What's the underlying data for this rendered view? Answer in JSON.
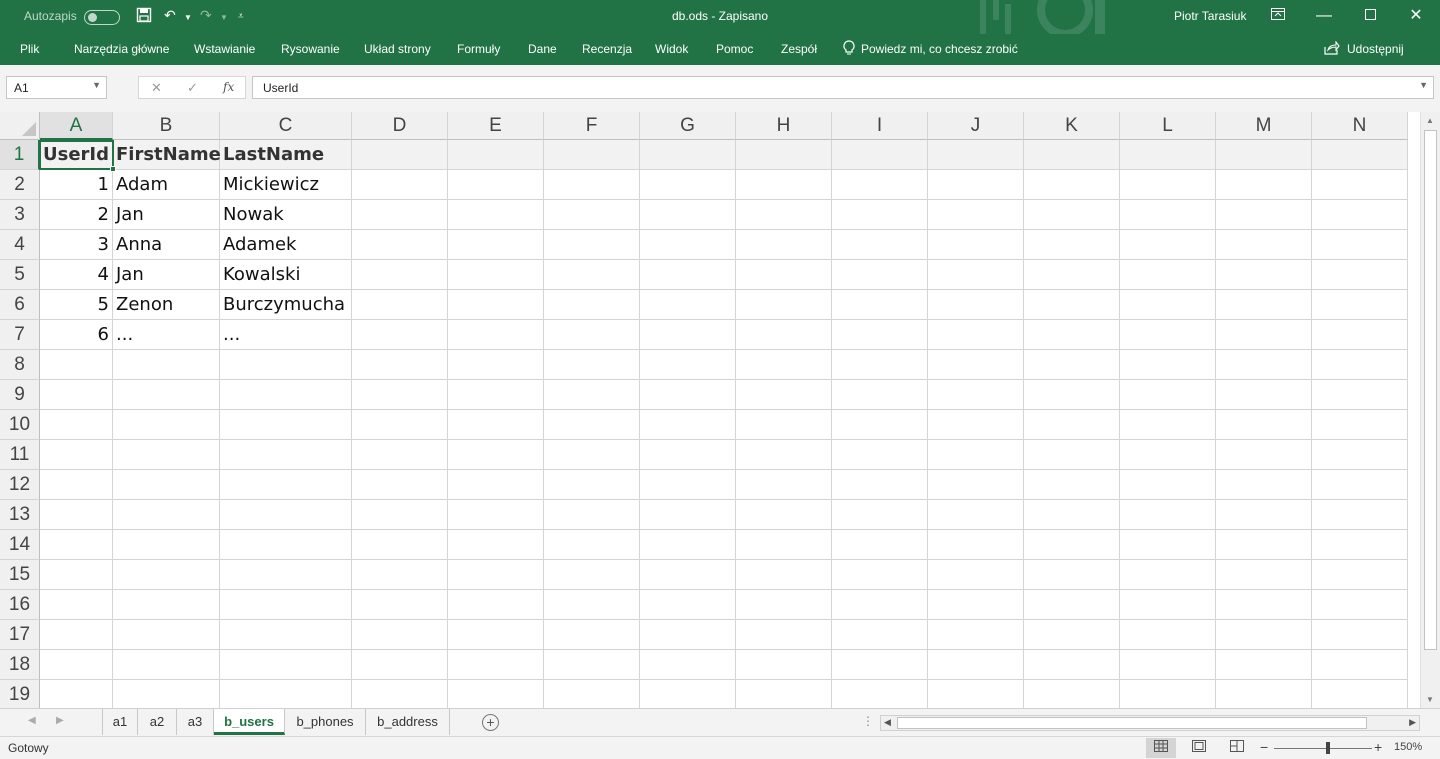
{
  "titlebar": {
    "autosave_label": "Autozapis",
    "title": "db.ods  -  Zapisano",
    "user": "Piotr Tarasiuk"
  },
  "menu": [
    "Plik",
    "Narzędzia główne",
    "Wstawianie",
    "Rysowanie",
    "Układ strony",
    "Formuły",
    "Dane",
    "Recenzja",
    "Widok",
    "Pomoc",
    "Zespół"
  ],
  "tell_me": "Powiedz mi, co chcesz zrobić",
  "share": "Udostępnij",
  "formula_bar": {
    "name_box": "A1",
    "fx": "fx",
    "formula": "UserId"
  },
  "columns": [
    "A",
    "B",
    "C",
    "D",
    "E",
    "F",
    "G",
    "H",
    "I",
    "J",
    "K",
    "L",
    "M",
    "N"
  ],
  "rows": [
    "1",
    "2",
    "3",
    "4",
    "5",
    "6",
    "7",
    "8",
    "9",
    "10",
    "11",
    "12",
    "13",
    "14",
    "15",
    "16",
    "17",
    "18",
    "19"
  ],
  "table": {
    "headers": [
      "UserId",
      "FirstName",
      "LastName"
    ],
    "data": [
      [
        "1",
        "Adam",
        "Mickiewicz"
      ],
      [
        "2",
        "Jan",
        "Nowak"
      ],
      [
        "3",
        "Anna",
        "Adamek"
      ],
      [
        "4",
        "Jan",
        "Kowalski"
      ],
      [
        "5",
        "Zenon",
        "Burczymucha"
      ],
      [
        "6",
        "...",
        "..."
      ]
    ]
  },
  "sheets": [
    "a1",
    "a2",
    "a3",
    "b_users",
    "b_phones",
    "b_address"
  ],
  "active_sheet": "b_users",
  "status": {
    "ready": "Gotowy",
    "zoom": "150%"
  },
  "colors": {
    "accent": "#217346",
    "header_bg": "#f0f0f0",
    "grid_line": "#d4d4d4"
  }
}
